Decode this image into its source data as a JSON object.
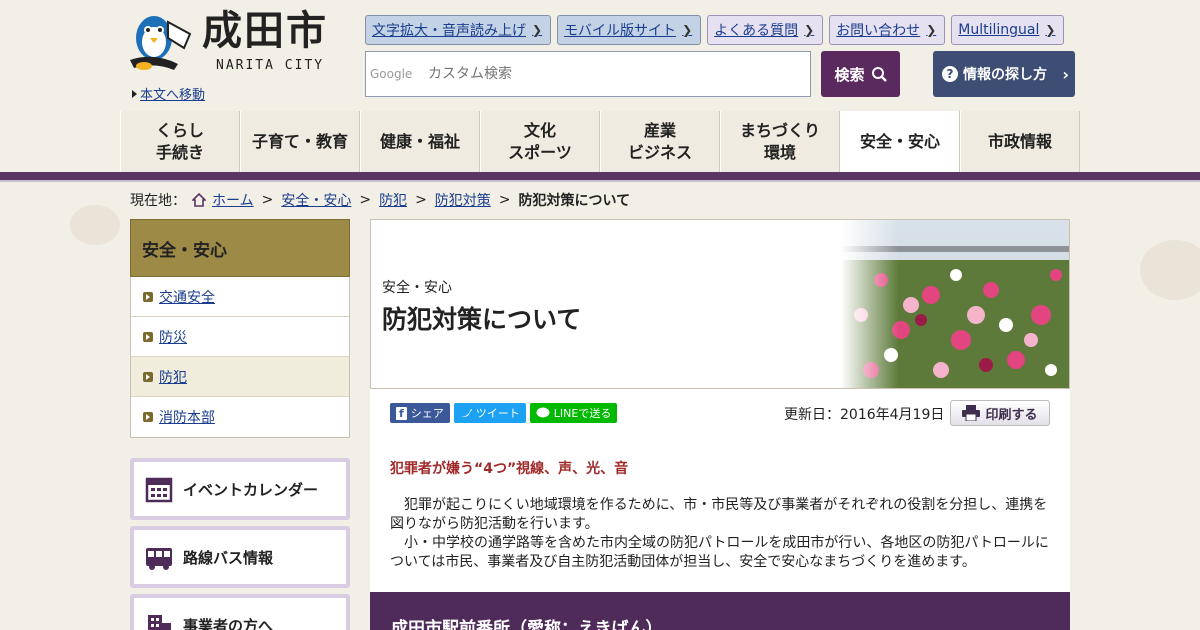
{
  "logo": {
    "title": "成田市",
    "subtitle": "NARITA CITY"
  },
  "skip_link": "本文へ移動",
  "top_links": [
    {
      "label": "文字拡大・音声読み上げ",
      "style": "blue"
    },
    {
      "label": "モバイル版サイト",
      "style": "blue"
    },
    {
      "label": "よくある質問",
      "style": "purple"
    },
    {
      "label": "お問い合わせ",
      "style": "purple"
    },
    {
      "label": "Multilingual",
      "style": "purple"
    }
  ],
  "search": {
    "brand": "Google",
    "placeholder": "カスタム検索",
    "button_label": "検索",
    "find_label": "情報の探し方"
  },
  "global_nav": [
    {
      "label": "くらし\n手続き",
      "active": false
    },
    {
      "label": "子育て・教育",
      "active": false
    },
    {
      "label": "健康・福祉",
      "active": false
    },
    {
      "label": "文化\nスポーツ",
      "active": false
    },
    {
      "label": "産業\nビジネス",
      "active": false
    },
    {
      "label": "まちづくり\n環境",
      "active": false
    },
    {
      "label": "安全・安心",
      "active": true
    },
    {
      "label": "市政情報",
      "active": false
    }
  ],
  "breadcrumb": {
    "prefix": "現在地：",
    "links": [
      "ホーム",
      "安全・安心",
      "防犯",
      "防犯対策"
    ],
    "current": "防犯対策について"
  },
  "sidebar": {
    "heading": "安全・安心",
    "items": [
      {
        "label": "交通安全",
        "active": false
      },
      {
        "label": "防災",
        "active": false
      },
      {
        "label": "防犯",
        "active": true
      },
      {
        "label": "消防本部",
        "active": false
      }
    ],
    "banners": [
      {
        "label": "イベントカレンダー",
        "icon": "calendar-icon"
      },
      {
        "label": "路線バス情報",
        "icon": "bus-icon"
      },
      {
        "label": "事業者の方へ",
        "icon": "building-icon"
      }
    ]
  },
  "main": {
    "category": "安全・安心",
    "title": "防犯対策について",
    "share": {
      "facebook": "シェア",
      "twitter": "ツイート",
      "line": "LINEで送る"
    },
    "updated": "更新日：2016年4月19日",
    "print_label": "印刷する",
    "sub_heading": "犯罪者が嫌う“4つ”視線、声、光、音",
    "paragraphs": [
      "犯罪が起こりにくい地域環境を作るために、市・市民等及び事業者がそれぞれの役割を分担し、連携を図りながら防犯活動を行います。",
      "小・中学校の通学路等を含めた市内全域の防犯パトロールを成田市が行い、各地区の防犯パトロールについては市民、事業者及び自主防犯活動団体が担当し、安全で安心なまちづくりを進めます。"
    ],
    "section_heading": "成田市駅前番所（愛称：えきばん）"
  },
  "colors": {
    "nav_bar": "#5a3463",
    "sidebar_heading": "#9e8a47",
    "search_button": "#5a2a5e",
    "find_button": "#3d4d74",
    "sub_heading": "#a02a2a"
  }
}
